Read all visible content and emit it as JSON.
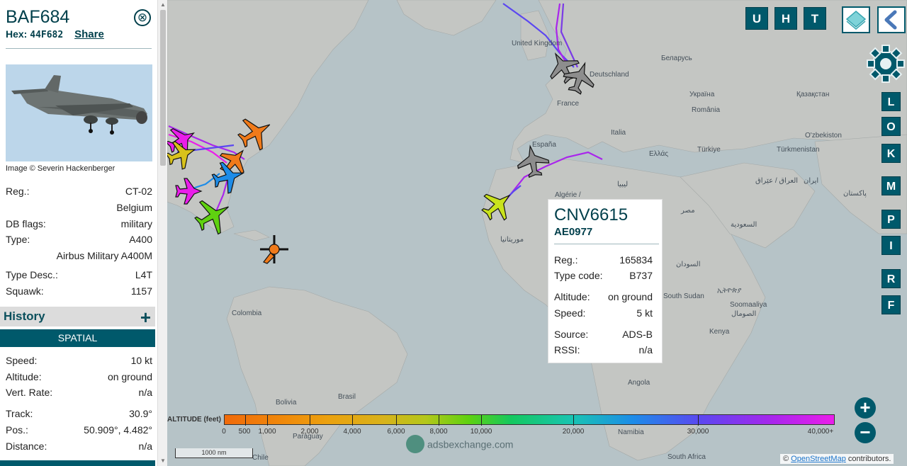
{
  "sidebar": {
    "callsign": "BAF684",
    "hex_label": "Hex:",
    "hex": "44F682",
    "share": "Share",
    "close": "⊗",
    "photo_credit": "Image © Severin Hackenberger",
    "details": [
      {
        "key": "Reg.:",
        "value": "CT-02"
      },
      {
        "key": "",
        "value": "Belgium"
      },
      {
        "key": "DB flags:",
        "value": "military"
      },
      {
        "key": "Type:",
        "value": "A400"
      },
      {
        "key": "",
        "value": "Airbus Military A400M"
      },
      {
        "key": "Type Desc.:",
        "value": "L4T"
      },
      {
        "key": "Squawk:",
        "value": "1157"
      }
    ],
    "history_label": "History",
    "history_plus": "+",
    "spatial_label": "SPATIAL",
    "spatial": [
      {
        "key": "Speed:",
        "value": "10 kt"
      },
      {
        "key": "Altitude:",
        "value": "on ground"
      },
      {
        "key": "Vert. Rate:",
        "value": "n/a"
      },
      {
        "key": "Track:",
        "value": "30.9°"
      },
      {
        "key": "Pos.:",
        "value": "50.909°, 4.482°"
      },
      {
        "key": "Distance:",
        "value": "n/a"
      }
    ]
  },
  "toolbar": {
    "top_buttons": [
      "U",
      "H",
      "T"
    ],
    "side_buttons": [
      "L",
      "O",
      "K",
      "M",
      "P",
      "I",
      "R",
      "F"
    ]
  },
  "map_labels": [
    {
      "text": "United Kingdom"
    },
    {
      "text": "Deutschland"
    },
    {
      "text": "France"
    },
    {
      "text": "Беларусь"
    },
    {
      "text": "Україна"
    },
    {
      "text": "Қазақстан"
    },
    {
      "text": "România"
    },
    {
      "text": "Italia"
    },
    {
      "text": "España"
    },
    {
      "text": "Ελλάς"
    },
    {
      "text": "Türkiye"
    },
    {
      "text": "O'zbekiston"
    },
    {
      "text": "Türkmenistan"
    },
    {
      "text": "العراق / عێراق"
    },
    {
      "text": "ایران"
    },
    {
      "text": "پاکستان"
    },
    {
      "text": "ليبيا"
    },
    {
      "text": "مصر"
    },
    {
      "text": "السعودية"
    },
    {
      "text": "Algérie /"
    },
    {
      "text": "موريتانيا"
    },
    {
      "text": "السودان"
    },
    {
      "text": "South Sudan"
    },
    {
      "text": "ኢትዮጵያ"
    },
    {
      "text": "Soomaaliya"
    },
    {
      "text": "الصومال"
    },
    {
      "text": "Kenya"
    },
    {
      "text": "Angola"
    },
    {
      "text": "Namibia"
    },
    {
      "text": "South Africa"
    },
    {
      "text": "Colombia"
    },
    {
      "text": "Brasil"
    },
    {
      "text": "Bolivia"
    },
    {
      "text": "Paraguay"
    },
    {
      "text": "Chile"
    }
  ],
  "popup": {
    "callsign": "CNV6615",
    "hex": "AE0977",
    "rows": [
      {
        "key": "Reg.:",
        "value": "165834"
      },
      {
        "key": "Type code:",
        "value": "B737"
      },
      {
        "key": "Altitude:",
        "value": "on ground"
      },
      {
        "key": "Speed:",
        "value": "5 kt"
      },
      {
        "key": "Source:",
        "value": "ADS-B"
      },
      {
        "key": "RSSI:",
        "value": "n/a"
      }
    ]
  },
  "altitude_legend": {
    "title": "ALTITUDE (feet)",
    "ticks": [
      "0",
      "500",
      "1,000",
      "2,000",
      "4,000",
      "6,000",
      "8,000",
      "10,000",
      "20,000",
      "30,000",
      "40,000+"
    ]
  },
  "scale": "1000 nm",
  "watermark": "adsbexchange.com",
  "attribution": {
    "prefix": "©",
    "link": "OpenStreetMap",
    "suffix": "contributors."
  },
  "zoom_in": "+",
  "zoom_out": "−",
  "colors": {
    "accent": "#00596b",
    "dark": "#003f4b"
  }
}
